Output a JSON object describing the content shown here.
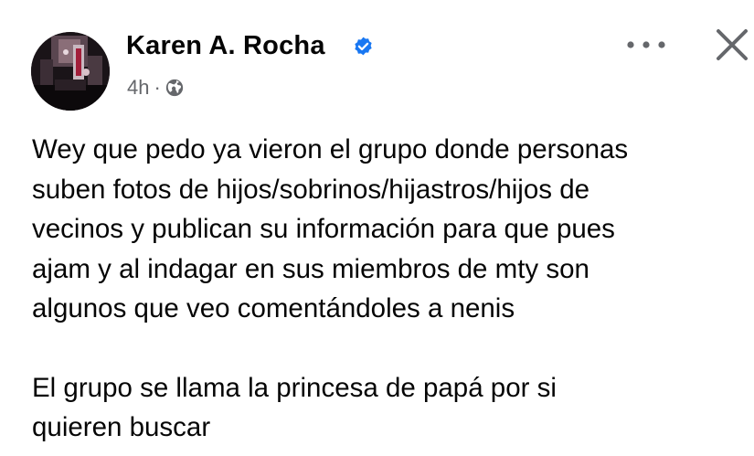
{
  "post": {
    "author": {
      "name": "Karen A. Rocha",
      "verified": true
    },
    "timestamp": "4h",
    "separator": "·",
    "audience_icon": "globe-icon",
    "menu_icon": "more-options-icon",
    "close_icon": "close-icon",
    "paragraphs": [
      "Wey que pedo ya vieron el grupo donde personas\nsuben fotos de hijos/sobrinos/hijastros/hijos de\nvecinos y publican su información para que pues\najam y al indagar en sus miembros de mty son\nalgunos que veo comentándoles a nenis",
      "El grupo se llama la princesa de papá por si\nquieren buscar"
    ]
  },
  "colors": {
    "verified_badge": "#1877f2",
    "meta_text": "#65676b",
    "body_text": "#050505",
    "icon_gray": "#65676b"
  }
}
